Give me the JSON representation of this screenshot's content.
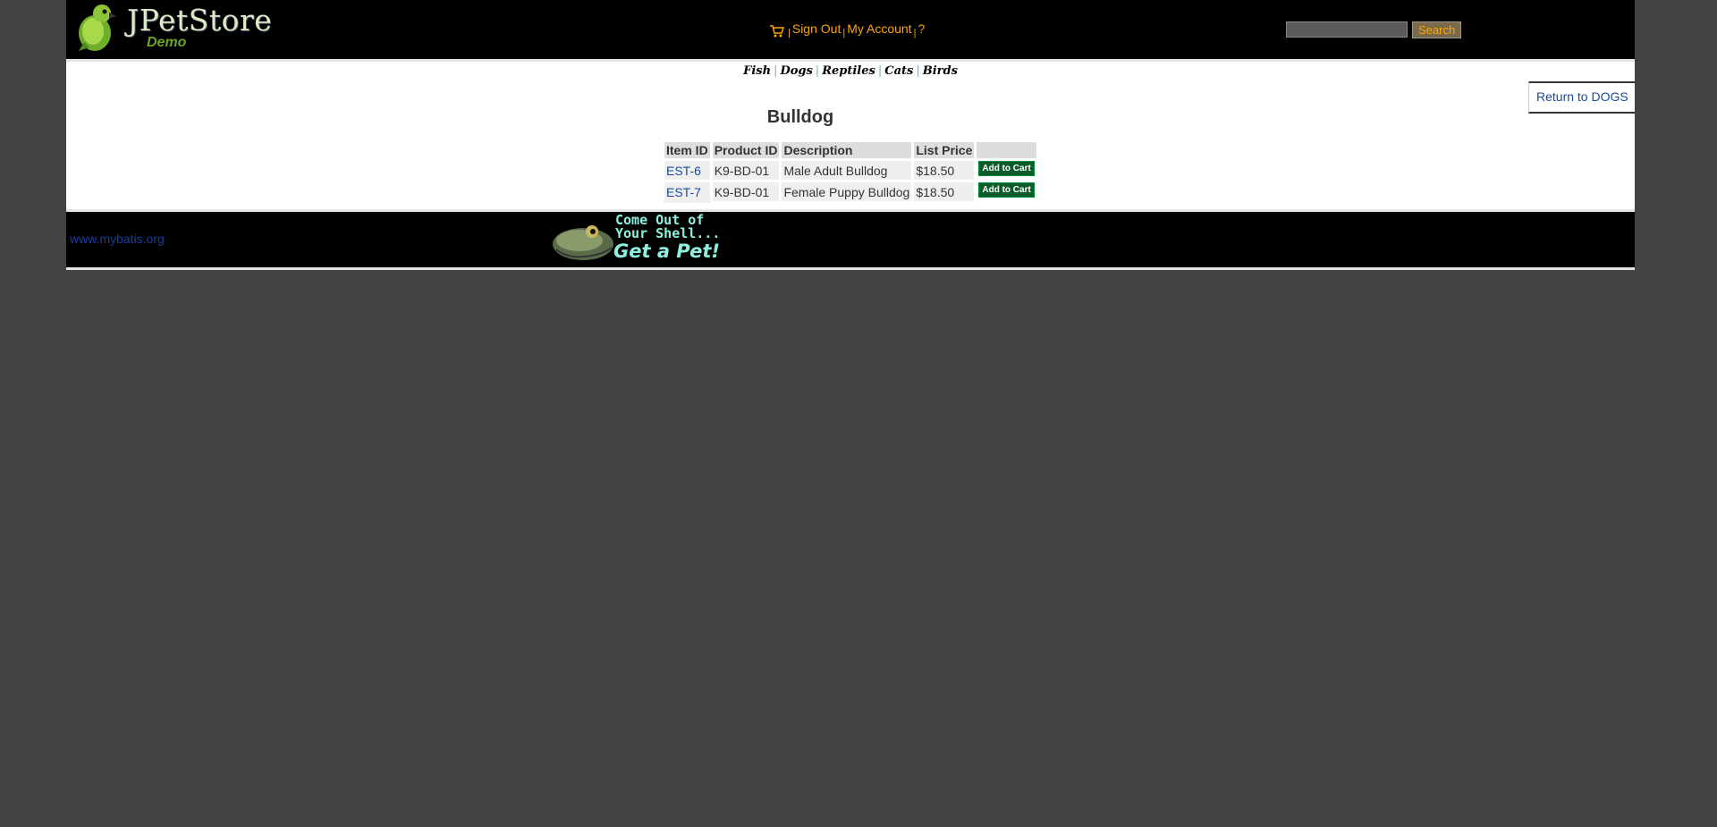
{
  "header": {
    "logo": {
      "title": "JPetStore",
      "subtitle": "Demo"
    },
    "menu": {
      "sign_out": "Sign Out",
      "my_account": "My Account",
      "help": "?",
      "separator": "|"
    },
    "search": {
      "value": "",
      "button": "Search"
    }
  },
  "quicklinks": [
    "Fish",
    "Dogs",
    "Reptiles",
    "Cats",
    "Birds"
  ],
  "return_link": "Return to DOGS",
  "product": {
    "name": "Bulldog"
  },
  "table": {
    "headers": [
      "Item ID",
      "Product ID",
      "Description",
      "List Price",
      ""
    ],
    "rows": [
      {
        "item_id": "EST-6",
        "product_id": "K9-BD-01",
        "description": "Male Adult Bulldog",
        "price": "$18.50",
        "action": "Add to Cart"
      },
      {
        "item_id": "EST-7",
        "product_id": "K9-BD-01",
        "description": "Female Puppy Bulldog",
        "price": "$18.50",
        "action": "Add to Cart"
      }
    ]
  },
  "footer": {
    "link": "www.mybatis.org",
    "banner": {
      "line1": "Come Out of",
      "line2": "Your Shell...",
      "line3": "Get a Pet!"
    }
  },
  "colors": {
    "page_bg": "#434343",
    "accent": "#ffa500",
    "link": "#1a4aa0",
    "cart_button": "#0d5a2a"
  },
  "icons": [
    "cart-icon",
    "parrot-logo-icon",
    "frog-banner-image"
  ]
}
